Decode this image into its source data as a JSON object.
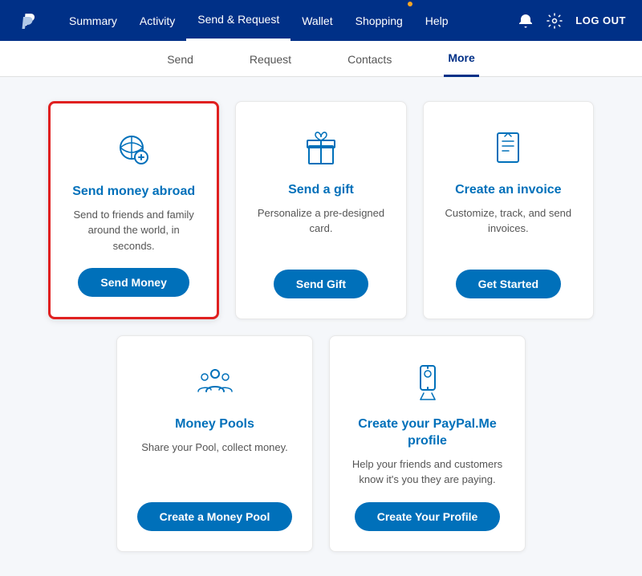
{
  "topNav": {
    "logo_alt": "PayPal",
    "links": [
      {
        "id": "summary",
        "label": "Summary",
        "active": false
      },
      {
        "id": "activity",
        "label": "Activity",
        "active": false
      },
      {
        "id": "send-request",
        "label": "Send & Request",
        "active": true
      },
      {
        "id": "wallet",
        "label": "Wallet",
        "active": false
      },
      {
        "id": "shopping",
        "label": "Shopping",
        "active": false,
        "dot": true
      },
      {
        "id": "help",
        "label": "Help",
        "active": false
      }
    ],
    "logout_label": "LOG OUT"
  },
  "subNav": {
    "items": [
      {
        "id": "send",
        "label": "Send",
        "active": false
      },
      {
        "id": "request",
        "label": "Request",
        "active": false
      },
      {
        "id": "contacts",
        "label": "Contacts",
        "active": false
      },
      {
        "id": "more",
        "label": "More",
        "active": true
      }
    ]
  },
  "cards": {
    "top_row": [
      {
        "id": "send-abroad",
        "title": "Send money abroad",
        "desc": "Send to friends and family around the world, in seconds.",
        "btn_label": "Send Money",
        "highlighted": true
      },
      {
        "id": "send-gift",
        "title": "Send a gift",
        "desc": "Personalize a pre-designed card.",
        "btn_label": "Send Gift",
        "highlighted": false
      },
      {
        "id": "create-invoice",
        "title": "Create an invoice",
        "desc": "Customize, track, and send invoices.",
        "btn_label": "Get Started",
        "highlighted": false
      }
    ],
    "bottom_row": [
      {
        "id": "money-pools",
        "title": "Money Pools",
        "desc": "Share your Pool, collect money.",
        "btn_label": "Create a Money Pool",
        "highlighted": false
      },
      {
        "id": "paypalme",
        "title": "Create your PayPal.Me profile",
        "desc": "Help your friends and customers know it's you they are paying.",
        "btn_label": "Create Your Profile",
        "highlighted": false
      }
    ]
  }
}
